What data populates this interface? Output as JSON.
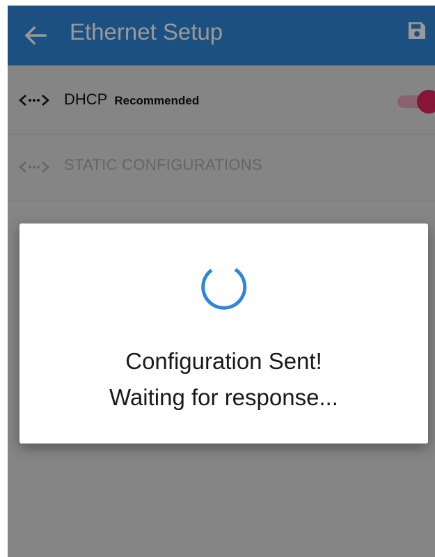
{
  "app_bar": {
    "title": "Ethernet Setup",
    "back_icon": "arrow-left-icon",
    "save_icon": "save-icon",
    "color": "#2f86d8"
  },
  "options": [
    {
      "icon": "ethernet-icon",
      "label": "DHCP",
      "tag": "Recommended",
      "toggle_on": true,
      "enabled": true
    },
    {
      "icon": "ethernet-icon",
      "label": "STATIC CONFIGURATIONS",
      "enabled": false
    }
  ],
  "dialog": {
    "icon": "loading-spinner-icon",
    "line1": "Configuration Sent!",
    "line2": "Waiting for response..."
  },
  "colors": {
    "accent": "#e0245e",
    "spinner": "#2f86d8"
  }
}
